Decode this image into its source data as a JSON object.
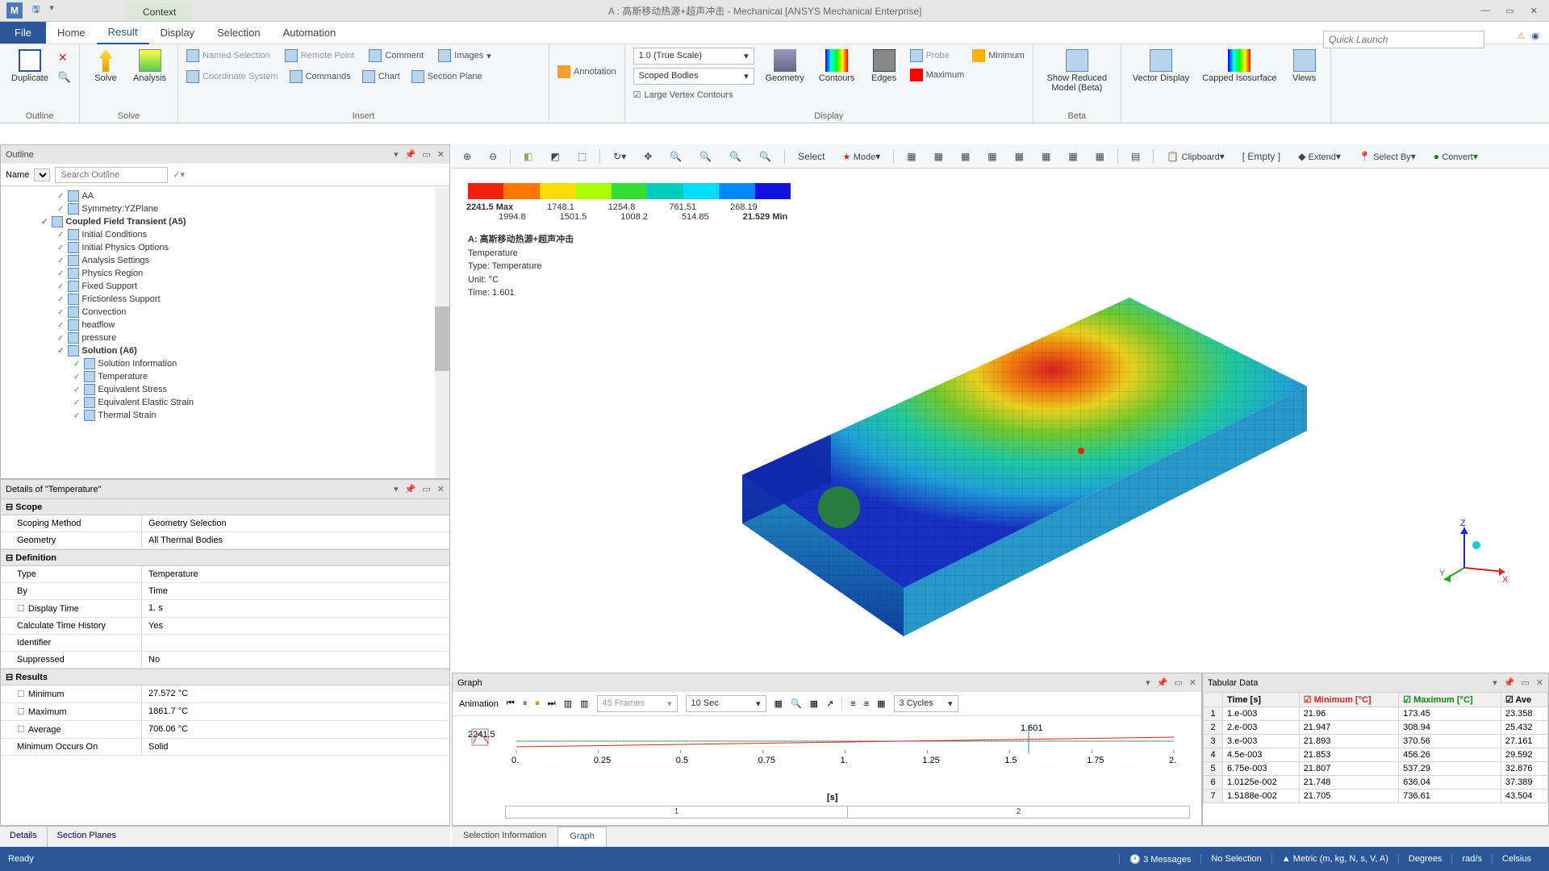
{
  "title": "A : 高斯移动热源+超声冲击 - Mechanical [ANSYS Mechanical Enterprise]",
  "context_tab": "Context",
  "ribbon_tabs": [
    "Home",
    "Result",
    "Display",
    "Selection",
    "Automation"
  ],
  "file_tab": "File",
  "quick_launch": "Quick Launch",
  "ribbon": {
    "outline_group": "Outline",
    "duplicate": "Duplicate",
    "solve_group": "Solve",
    "solve": "Solve",
    "analysis": "Analysis",
    "insert_group": "Insert",
    "named_sel": "Named Selection",
    "remote_point": "Remote Point",
    "comment": "Comment",
    "images": "Images",
    "coord_sys": "Coordinate System",
    "commands": "Commands",
    "chart": "Chart",
    "section_plane": "Section Plane",
    "annotation": "Annotation",
    "scale_dd": "1.0 (True Scale)",
    "scoped_dd": "Scoped Bodies",
    "large_vertex": "Large Vertex Contours",
    "geometry": "Geometry",
    "contours": "Contours",
    "edges": "Edges",
    "probe": "Probe",
    "minimum": "Minimum",
    "maximum": "Maximum",
    "show_reduced": "Show Reduced Model (Beta)",
    "vector_display": "Vector Display",
    "capped_iso": "Capped Isosurface",
    "views": "Views",
    "display_group": "Display",
    "beta_group": "Beta"
  },
  "view_toolbar": {
    "select": "Select",
    "mode": "Mode",
    "clipboard": "Clipboard",
    "empty": "[ Empty ]",
    "extend": "Extend",
    "select_by": "Select By",
    "convert": "Convert"
  },
  "outline": {
    "header": "Outline",
    "name_label": "Name",
    "search_ph": "Search Outline",
    "tree": [
      {
        "lvl": 1,
        "bold": false,
        "text": "AA"
      },
      {
        "lvl": 1,
        "bold": false,
        "text": "Symmetry:YZPlane"
      },
      {
        "lvl": 0,
        "bold": true,
        "text": "Coupled Field Transient (A5)"
      },
      {
        "lvl": 1,
        "bold": false,
        "text": "Initial Conditions"
      },
      {
        "lvl": 1,
        "bold": false,
        "text": "Initial Physics Options"
      },
      {
        "lvl": 1,
        "bold": false,
        "text": "Analysis Settings"
      },
      {
        "lvl": 1,
        "bold": false,
        "text": "Physics Region"
      },
      {
        "lvl": 1,
        "bold": false,
        "text": "Fixed Support"
      },
      {
        "lvl": 1,
        "bold": false,
        "text": "Frictionless Support"
      },
      {
        "lvl": 1,
        "bold": false,
        "text": "Convection"
      },
      {
        "lvl": 1,
        "bold": false,
        "text": "heatflow"
      },
      {
        "lvl": 1,
        "bold": false,
        "text": "pressure"
      },
      {
        "lvl": 1,
        "bold": true,
        "text": "Solution (A6)"
      },
      {
        "lvl": 2,
        "bold": false,
        "text": "Solution Information"
      },
      {
        "lvl": 2,
        "bold": false,
        "text": "Temperature"
      },
      {
        "lvl": 2,
        "bold": false,
        "text": "Equivalent Stress"
      },
      {
        "lvl": 2,
        "bold": false,
        "text": "Equivalent Elastic Strain"
      },
      {
        "lvl": 2,
        "bold": false,
        "text": "Thermal Strain"
      }
    ]
  },
  "details": {
    "header": "Details of \"Temperature\"",
    "cats": {
      "scope": "Scope",
      "definition": "Definition",
      "results": "Results"
    },
    "rows": {
      "scoping_method_k": "Scoping Method",
      "scoping_method_v": "Geometry Selection",
      "geometry_k": "Geometry",
      "geometry_v": "All Thermal Bodies",
      "type_k": "Type",
      "type_v": "Temperature",
      "by_k": "By",
      "by_v": "Time",
      "display_time_k": "Display Time",
      "display_time_v": "1. s",
      "calc_hist_k": "Calculate Time History",
      "calc_hist_v": "Yes",
      "identifier_k": "Identifier",
      "identifier_v": "",
      "suppressed_k": "Suppressed",
      "suppressed_v": "No",
      "min_k": "Minimum",
      "min_v": "27.572 °C",
      "max_k": "Maximum",
      "max_v": "1861.7 °C",
      "avg_k": "Average",
      "avg_v": "706.06 °C",
      "min_occurs_k": "Minimum Occurs On",
      "min_occurs_v": "Solid"
    }
  },
  "bottom_left_tabs": [
    "Details",
    "Section Planes"
  ],
  "legend": {
    "max_label": "2241.5 Max",
    "row1": [
      "1748.1",
      "1254.8",
      "761.51",
      "268.19"
    ],
    "row2": [
      "1994.8",
      "1501.5",
      "1008.2",
      "514.85"
    ],
    "min_label": "21.529  Min"
  },
  "info": {
    "title": "A: 高斯移动热源+超声冲击",
    "line1": "Temperature",
    "line2": "Type: Temperature",
    "line3": "Unit: °C",
    "line4": "Time: 1.601"
  },
  "triad": {
    "x": "X",
    "y": "Y",
    "z": "Z"
  },
  "graph": {
    "header": "Graph",
    "animation": "Animation",
    "frames": "45 Frames",
    "sec": "10 Sec",
    "cycles": "3 Cycles",
    "ymax": "2241.5",
    "marker": "1.601",
    "ticks": [
      "0.",
      "0.25",
      "0.5",
      "0.75",
      "1.",
      "1.25",
      "1.5",
      "1.75",
      "2."
    ],
    "axis": "[s]",
    "slider": [
      "1",
      "2"
    ]
  },
  "tabular": {
    "header": "Tabular Data",
    "cols": [
      "",
      "Time [s]",
      "Minimum [°C]",
      "Maximum [°C]",
      "Ave"
    ],
    "rows": [
      [
        "1",
        "1.e-003",
        "21.96",
        "173.45",
        "23.358"
      ],
      [
        "2",
        "2.e-003",
        "21.947",
        "308.94",
        "25.432"
      ],
      [
        "3",
        "3.e-003",
        "21.893",
        "370.56",
        "27.161"
      ],
      [
        "4",
        "4.5e-003",
        "21.853",
        "456.26",
        "29.592"
      ],
      [
        "5",
        "6.75e-003",
        "21.807",
        "537.29",
        "32.876"
      ],
      [
        "6",
        "1.0125e-002",
        "21.748",
        "636.04",
        "37.389"
      ],
      [
        "7",
        "1.5188e-002",
        "21.705",
        "736.61",
        "43.504"
      ]
    ]
  },
  "bottom_right_tabs": [
    "Selection Information",
    "Graph"
  ],
  "status": {
    "ready": "Ready",
    "messages": "3 Messages",
    "no_sel": "No Selection",
    "units": "Metric (m, kg, N, s, V, A)",
    "deg": "Degrees",
    "rad": "rad/s",
    "cel": "Celsius"
  }
}
